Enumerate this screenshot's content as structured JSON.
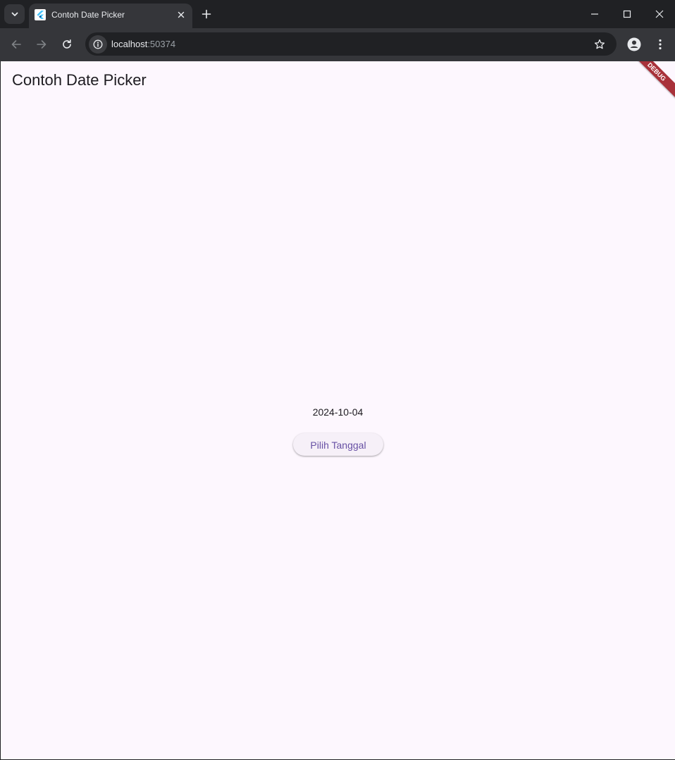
{
  "browser": {
    "tab": {
      "title": "Contoh Date Picker",
      "favicon": "flutter-icon"
    },
    "address_bar": {
      "host": "localhost",
      "port": ":50374"
    },
    "icons": {
      "tab_search": "chevron-down-icon",
      "tab_close": "close-icon",
      "new_tab": "plus-icon",
      "minimize": "minimize-icon",
      "maximize": "maximize-icon",
      "close_window": "close-icon",
      "back": "arrow-left-icon",
      "forward": "arrow-right-icon",
      "reload": "reload-icon",
      "site_info": "info-icon",
      "bookmark": "star-icon",
      "profile": "profile-icon",
      "menu": "kebab-menu-icon"
    }
  },
  "app": {
    "title": "Contoh Date Picker",
    "selected_date": "2024-10-04",
    "pick_button_label": "Pilih Tanggal",
    "debug_banner": "DEBUG",
    "colors": {
      "background": "#fdf7fe",
      "button_text": "#6750a4",
      "button_background": "#f6f0f8",
      "debug_banner": "#a8313a"
    }
  }
}
